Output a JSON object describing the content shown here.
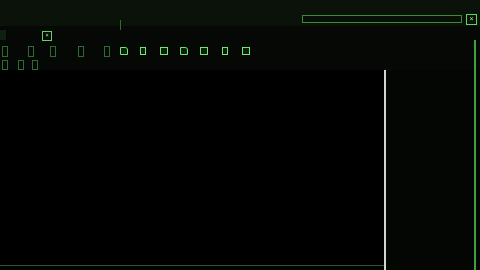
{
  "address_bar": {
    "path": ""
  },
  "top_menu": {
    "items": [
      "",
      "",
      "",
      "",
      ""
    ]
  },
  "search": {
    "value": ""
  },
  "close_label": "×",
  "tab": {
    "title": "",
    "close": "×"
  },
  "toolbar": {
    "buttons": [
      "",
      "",
      "",
      "",
      ""
    ]
  },
  "side_buttons": [
    "",
    "",
    ""
  ],
  "code_lines": [
    "",
    "",
    "",
    "",
    "",
    "",
    "",
    "",
    "",
    "",
    "",
    "",
    "",
    "",
    "",
    "",
    "",
    "",
    "",
    "",
    "",
    "",
    "",
    "",
    "",
    "",
    "",
    "",
    "",
    "",
    "",
    ""
  ],
  "selection_text": "",
  "colors": {
    "text": "#6ee86e",
    "background": "#000000",
    "selection": "#2a4a9a",
    "frame": "#3fa03f"
  },
  "icons": [
    "close-icon",
    "folder-icon",
    "file-icon",
    "save-icon"
  ]
}
